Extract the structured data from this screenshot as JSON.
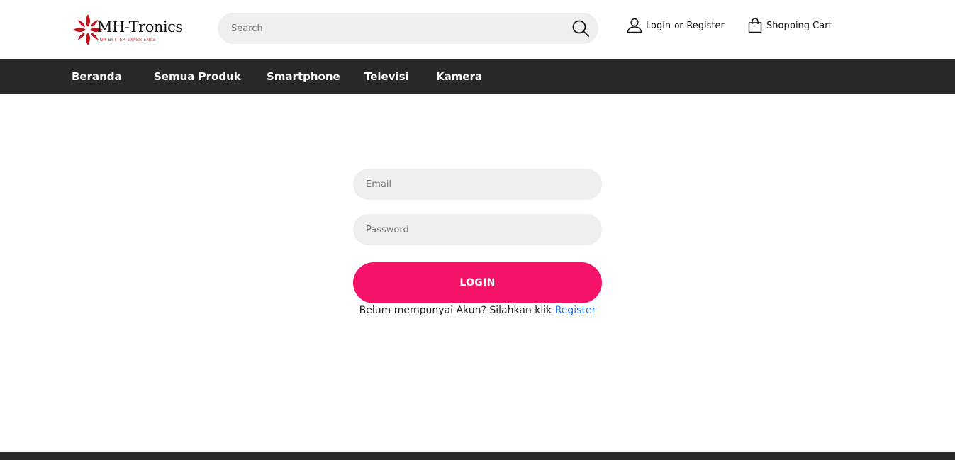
{
  "brand": {
    "name": "MH-Tronics",
    "tagline": "FOR BETTER EXPERIENCE",
    "colors": {
      "logo_red": "#c0151e",
      "accent_pink": "#f41369",
      "nav_bg": "#282828",
      "link_blue": "#1a73e8"
    }
  },
  "header": {
    "search": {
      "placeholder": "Search",
      "value": "",
      "icon": "search-icon"
    },
    "account": {
      "icon": "user-icon",
      "login_label": "Login",
      "or_label": "or",
      "register_label": "Register"
    },
    "cart": {
      "icon": "shopping-bag-icon",
      "label": "Shopping Cart"
    }
  },
  "nav": {
    "items": [
      {
        "label": "Beranda"
      },
      {
        "label": "Semua Produk"
      },
      {
        "label": "Smartphone"
      },
      {
        "label": "Televisi"
      },
      {
        "label": "Kamera"
      }
    ]
  },
  "login_form": {
    "email": {
      "placeholder": "Email",
      "value": ""
    },
    "password": {
      "placeholder": "Password",
      "value": ""
    },
    "submit_label": "LOGIN",
    "register_prompt": "Belum mempunyai Akun? Silahkan klik",
    "register_link": "Register"
  }
}
